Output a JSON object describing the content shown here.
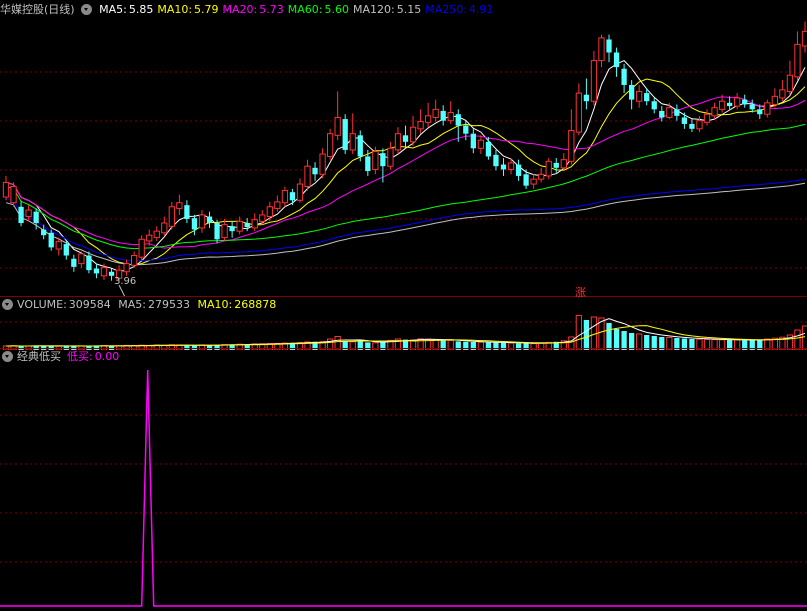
{
  "panels": {
    "price": {
      "stock_name": "华媒控股(日线)",
      "ma_items": [
        {
          "label": "MA5:",
          "value": "5.85",
          "color": "#ffffff"
        },
        {
          "label": "MA10:",
          "value": "5.79",
          "color": "#ffff00"
        },
        {
          "label": "MA20:",
          "value": "5.73",
          "color": "#ff00ff"
        },
        {
          "label": "MA60:",
          "value": "5.60",
          "color": "#00ff00"
        },
        {
          "label": "MA120:",
          "value": "5.15",
          "color": "#c0c0c0"
        },
        {
          "label": "MA250:",
          "value": "4.91",
          "color": "#0000ff"
        }
      ],
      "low_label": "3.96",
      "marker_label": "涨"
    },
    "volume": {
      "label": "VOLUME:",
      "value": "309584",
      "ma5_label": "MA5:",
      "ma5_value": "279533",
      "ma10_label": "MA10:",
      "ma10_value": "268878"
    },
    "indicator": {
      "name": "经典低买",
      "line_label": "低买:",
      "line_value": "0.00"
    }
  },
  "colors": {
    "up": "#ff3232",
    "down": "#54ffff",
    "grid": "#800000",
    "indicator_line": "#ff00ff"
  },
  "chart_data": [
    {
      "type": "candlestick",
      "title": "华媒控股(日线)",
      "ylim": [
        3.9,
        7.2
      ],
      "candles": [
        [
          5.02,
          5.2,
          5.28,
          4.98
        ],
        [
          4.95,
          5.15,
          5.2,
          4.9
        ],
        [
          4.9,
          4.7,
          4.97,
          4.66
        ],
        [
          4.78,
          4.86,
          4.92,
          4.72
        ],
        [
          4.84,
          4.7,
          4.88,
          4.62
        ],
        [
          4.62,
          4.55,
          4.68,
          4.5
        ],
        [
          4.58,
          4.4,
          4.62,
          4.36
        ],
        [
          4.38,
          4.47,
          4.52,
          4.3
        ],
        [
          4.44,
          4.3,
          4.48,
          4.25
        ],
        [
          4.26,
          4.16,
          4.31,
          4.1
        ],
        [
          4.2,
          4.32,
          4.35,
          4.15
        ],
        [
          4.3,
          4.12,
          4.35,
          4.08
        ],
        [
          4.14,
          4.08,
          4.2,
          4.02
        ],
        [
          4.05,
          4.15,
          4.2,
          4.0
        ],
        [
          4.1,
          4.05,
          4.14,
          3.99
        ],
        [
          4.02,
          4.12,
          4.18,
          3.96
        ],
        [
          4.1,
          4.2,
          4.25,
          4.05
        ],
        [
          4.18,
          4.3,
          4.35,
          4.15
        ],
        [
          4.28,
          4.5,
          4.55,
          4.24
        ],
        [
          4.48,
          4.55,
          4.62,
          4.42
        ],
        [
          4.52,
          4.6,
          4.66,
          4.48
        ],
        [
          4.58,
          4.7,
          4.78,
          4.55
        ],
        [
          4.66,
          4.9,
          4.96,
          4.62
        ],
        [
          4.88,
          4.95,
          5.05,
          4.8
        ],
        [
          4.92,
          4.75,
          4.98,
          4.7
        ],
        [
          4.76,
          4.62,
          4.8,
          4.55
        ],
        [
          4.64,
          4.8,
          4.86,
          4.58
        ],
        [
          4.78,
          4.7,
          4.84,
          4.64
        ],
        [
          4.7,
          4.5,
          4.74,
          4.45
        ],
        [
          4.52,
          4.68,
          4.75,
          4.48
        ],
        [
          4.66,
          4.6,
          4.72,
          4.52
        ],
        [
          4.6,
          4.72,
          4.78,
          4.56
        ],
        [
          4.7,
          4.65,
          4.76,
          4.6
        ],
        [
          4.64,
          4.74,
          4.82,
          4.6
        ],
        [
          4.72,
          4.8,
          4.86,
          4.68
        ],
        [
          4.78,
          4.9,
          4.96,
          4.72
        ],
        [
          4.88,
          4.96,
          5.04,
          4.84
        ],
        [
          4.95,
          5.1,
          5.15,
          4.9
        ],
        [
          5.08,
          4.98,
          5.12,
          4.92
        ],
        [
          4.98,
          5.18,
          5.25,
          4.95
        ],
        [
          5.15,
          5.4,
          5.48,
          5.1
        ],
        [
          5.38,
          5.3,
          5.45,
          5.22
        ],
        [
          5.3,
          5.55,
          5.62,
          5.25
        ],
        [
          5.52,
          5.8,
          5.86,
          5.48
        ],
        [
          5.78,
          6.0,
          6.32,
          5.72
        ],
        [
          5.98,
          5.6,
          6.04,
          5.55
        ],
        [
          5.6,
          5.8,
          6.05,
          5.55
        ],
        [
          5.78,
          5.52,
          5.84,
          5.46
        ],
        [
          5.52,
          5.34,
          5.6,
          5.28
        ],
        [
          5.36,
          5.58,
          5.64,
          5.3
        ],
        [
          5.56,
          5.4,
          5.62,
          5.2
        ],
        [
          5.4,
          5.62,
          5.7,
          5.36
        ],
        [
          5.6,
          5.8,
          5.88,
          5.55
        ],
        [
          5.78,
          5.7,
          5.9,
          5.62
        ],
        [
          5.7,
          5.88,
          6.02,
          5.65
        ],
        [
          5.86,
          5.95,
          6.1,
          5.8
        ],
        [
          5.94,
          6.02,
          6.18,
          5.88
        ],
        [
          6.0,
          6.1,
          6.22,
          5.95
        ],
        [
          6.08,
          5.96,
          6.15,
          5.9
        ],
        [
          5.96,
          6.06,
          6.2,
          5.92
        ],
        [
          6.04,
          5.9,
          6.1,
          5.7
        ],
        [
          5.9,
          5.8,
          5.96,
          5.72
        ],
        [
          5.8,
          5.62,
          5.86,
          5.56
        ],
        [
          5.62,
          5.72,
          5.78,
          5.55
        ],
        [
          5.7,
          5.52,
          5.76,
          5.48
        ],
        [
          5.54,
          5.4,
          5.6,
          5.35
        ],
        [
          5.42,
          5.36,
          5.5,
          5.28
        ],
        [
          5.36,
          5.44,
          5.5,
          5.3
        ],
        [
          5.42,
          5.28,
          5.48,
          5.22
        ],
        [
          5.3,
          5.16,
          5.36,
          5.12
        ],
        [
          5.18,
          5.24,
          5.3,
          5.12
        ],
        [
          5.24,
          5.3,
          5.38,
          5.2
        ],
        [
          5.28,
          5.46,
          5.5,
          5.24
        ],
        [
          5.44,
          5.38,
          5.5,
          5.32
        ],
        [
          5.38,
          5.48,
          5.56,
          5.34
        ],
        [
          5.46,
          5.84,
          6.1,
          5.42
        ],
        [
          5.82,
          6.3,
          6.42,
          5.78
        ],
        [
          6.28,
          6.2,
          6.48,
          6.1
        ],
        [
          6.2,
          6.7,
          6.82,
          6.15
        ],
        [
          6.7,
          6.98,
          7.02,
          6.62
        ],
        [
          6.96,
          6.8,
          7.02,
          6.68
        ],
        [
          6.8,
          6.62,
          6.86,
          6.5
        ],
        [
          6.6,
          6.4,
          6.66,
          6.3
        ],
        [
          6.4,
          6.22,
          6.46,
          6.1
        ],
        [
          6.2,
          6.32,
          6.4,
          6.12
        ],
        [
          6.3,
          6.2,
          6.36,
          6.15
        ],
        [
          6.2,
          6.1,
          6.24,
          6.05
        ],
        [
          6.08,
          6.0,
          6.14,
          5.95
        ],
        [
          6.0,
          6.12,
          6.18,
          5.98
        ],
        [
          6.1,
          6.02,
          6.16,
          5.96
        ],
        [
          6.0,
          5.92,
          6.06,
          5.86
        ],
        [
          5.92,
          5.86,
          5.98,
          5.82
        ],
        [
          5.86,
          5.96,
          6.02,
          5.82
        ],
        [
          5.94,
          6.04,
          6.1,
          5.9
        ],
        [
          6.02,
          6.12,
          6.18,
          5.98
        ],
        [
          6.1,
          6.2,
          6.28,
          6.06
        ],
        [
          6.18,
          6.14,
          6.26,
          6.1
        ],
        [
          6.14,
          6.24,
          6.3,
          6.1
        ],
        [
          6.22,
          6.16,
          6.28,
          6.12
        ],
        [
          6.16,
          6.1,
          6.22,
          6.06
        ],
        [
          6.1,
          6.04,
          6.16,
          5.98
        ],
        [
          6.04,
          6.18,
          6.22,
          6.0
        ],
        [
          6.16,
          6.26,
          6.36,
          6.12
        ],
        [
          6.24,
          6.34,
          6.46,
          6.2
        ],
        [
          6.32,
          6.52,
          6.7,
          6.28
        ],
        [
          6.5,
          6.9,
          7.06,
          6.45
        ],
        [
          6.88,
          7.06,
          7.18,
          6.8
        ]
      ]
    },
    {
      "type": "bar",
      "title": "VOLUME",
      "values": [
        40,
        42,
        38,
        40,
        44,
        40,
        42,
        38,
        40,
        42,
        40,
        38,
        42,
        44,
        40,
        42,
        46,
        44,
        48,
        46,
        50,
        46,
        52,
        50,
        48,
        46,
        50,
        48,
        50,
        54,
        56,
        58,
        56,
        60,
        62,
        64,
        66,
        70,
        72,
        74,
        80,
        82,
        84,
        110,
        135,
        90,
        82,
        88,
        76,
        72,
        78,
        96,
        110,
        104,
        100,
        112,
        108,
        104,
        98,
        96,
        86,
        82,
        80,
        78,
        76,
        74,
        72,
        70,
        68,
        66,
        64,
        70,
        76,
        82,
        92,
        130,
        345,
        300,
        330,
        320,
        270,
        210,
        190,
        170,
        160,
        150,
        140,
        130,
        125,
        120,
        115,
        110,
        108,
        106,
        104,
        102,
        100,
        100,
        98,
        98,
        102,
        110,
        118,
        128,
        150,
        200,
        240
      ],
      "ylim": [
        0,
        360
      ]
    },
    {
      "type": "line",
      "title": "经典低买",
      "series": [
        {
          "name": "低买",
          "spike_index": 18,
          "spike_value": 1.0,
          "baseline": 0.0
        }
      ],
      "ylim": [
        0,
        1
      ]
    }
  ]
}
